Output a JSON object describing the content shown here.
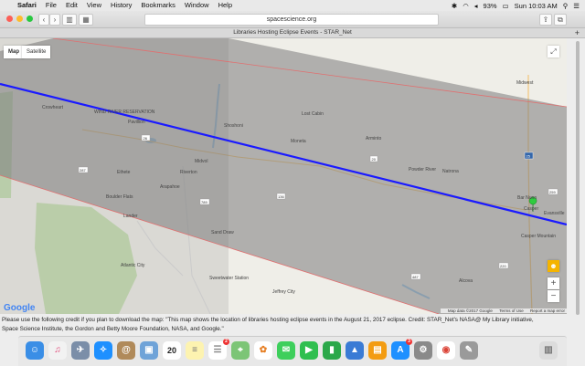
{
  "menubar": {
    "app": "Safari",
    "menus": [
      "File",
      "Edit",
      "View",
      "History",
      "Bookmarks",
      "Window",
      "Help"
    ],
    "battery": "93%",
    "clock": "Sun 10:03 AM"
  },
  "browser": {
    "url": "spacescience.org",
    "tab_title": "Libraries Hosting Eclipse Events - STAR_Net",
    "new_tab": "+"
  },
  "map": {
    "type_map": "Map",
    "type_satellite": "Satellite",
    "zoom_in": "+",
    "zoom_out": "−",
    "logo": "Google",
    "footer_data": "Map data ©2017 Google",
    "footer_terms": "Terms of Use",
    "footer_report": "Report a map error",
    "places": [
      "Crowheart",
      "Pavillion",
      "Shoshoni",
      "Lost Cabin",
      "Arminto",
      "Midwest",
      "Moneta",
      "Midvol",
      "Riverton",
      "Ethete",
      "Arapahoe",
      "Powder River",
      "Natrona",
      "Boulder Flats",
      "Lander",
      "Bar Nunn",
      "Casper",
      "Evansville",
      "Sand Draw",
      "Casper Mountain",
      "Sweetwater Station",
      "Jeffrey City",
      "Atlantic City",
      "Alcova"
    ],
    "reservation_label": "WIND RIVER RESERVATION",
    "route_shields": [
      "26",
      "287",
      "789",
      "136",
      "20",
      "25",
      "220",
      "487",
      "259"
    ]
  },
  "credit_lines": [
    "Please use the following credit if you plan to download the map: \"This map shows the location of libraries hosting eclipse events in the August 21, 2017 eclipse. Credit: STAR_Net's NASA@ My Library initiative,",
    "Space Science Institute, the Gordon and Betty Moore Foundation, NASA, and Google.\""
  ],
  "dock": {
    "calendar_day": "20",
    "badges": [
      "2",
      "3"
    ],
    "icons": [
      "finder-icon",
      "itunes-icon",
      "launchpad-icon",
      "safari-icon",
      "contacts-icon",
      "preview-icon",
      "calendar-icon",
      "notes-icon",
      "reminders-icon",
      "maps-icon",
      "photos-icon",
      "messages-icon",
      "facetime-icon",
      "numbers-icon",
      "keynote-icon",
      "ibooks-icon",
      "appstore-icon",
      "system-preferences-icon",
      "chrome-icon",
      "scripts-icon",
      "trash-icon"
    ]
  },
  "colors": {
    "eclipse_path": "#1a1aff",
    "umbra_fill": "#8a8a8a",
    "boundary": "#e07070",
    "marker": "#2ecc40"
  }
}
